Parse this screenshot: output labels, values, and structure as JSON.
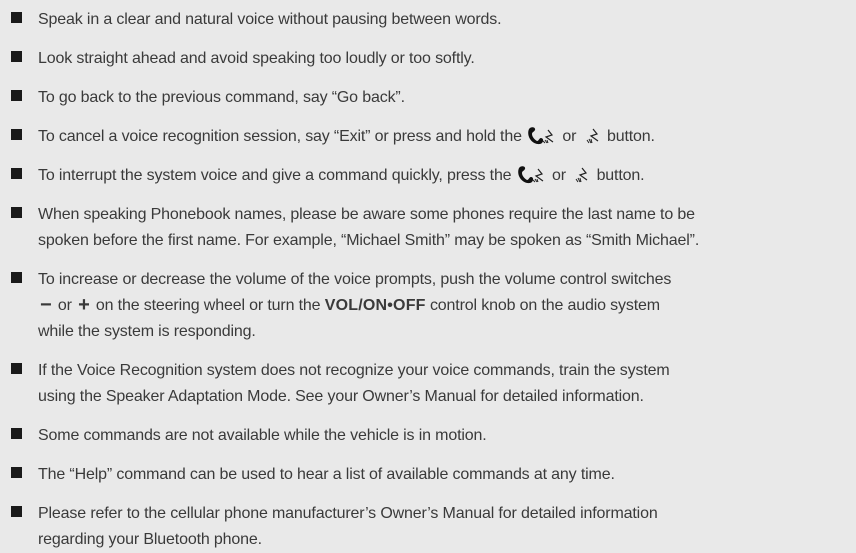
{
  "tips": [
    {
      "text": "Speak in a clear and natural voice without pausing between words."
    },
    {
      "text": "Look straight ahead and avoid speaking too loudly or too softly."
    },
    {
      "text": "To go back to the previous command, say “Go back”."
    },
    {
      "before": "To cancel a voice recognition session, say “Exit” or press and hold the",
      "between": "or",
      "after": "button."
    },
    {
      "before": "To interrupt the system voice and give a command quickly, press the",
      "between": "or",
      "after": "button."
    },
    {
      "line1": "When speaking Phonebook names, please be aware some phones require the last name to be",
      "line2": "spoken before the first name. For example, “Michael Smith” may be spoken as “Smith Michael”."
    },
    {
      "line1": "To increase or decrease the volume of the voice prompts, push the volume control switches",
      "minus": "−",
      "or": "or",
      "plus": "+",
      "mid": "on the steering wheel or turn the",
      "knob": "VOL/ON•OFF",
      "after": "control knob on the audio system",
      "line3": "while the system is responding."
    },
    {
      "line1": "If the Voice Recognition system does not recognize your voice commands, train the system",
      "line2": "using the Speaker Adaptation Mode. See your Owner’s Manual for detailed information."
    },
    {
      "text": "Some commands are not available while the vehicle is in motion."
    },
    {
      "text": "The “Help” command can be used to hear a list of available commands at any time."
    },
    {
      "line1": "Please refer to the cellular phone manufacturer’s Owner’s Manual for detailed information",
      "line2": "regarding your Bluetooth phone."
    }
  ],
  "icons": {
    "phone_talk": "phone-talk-icon",
    "talk": "talk-icon"
  }
}
